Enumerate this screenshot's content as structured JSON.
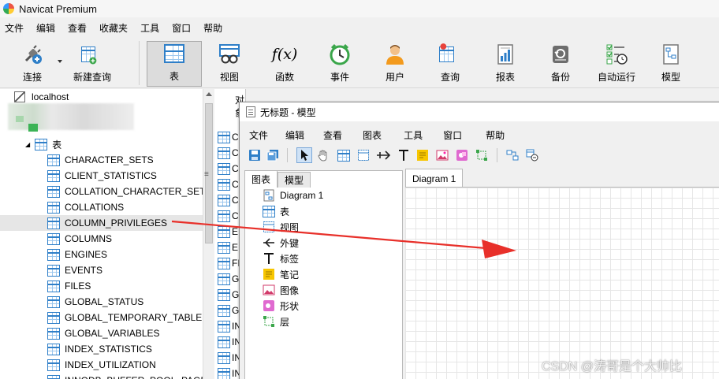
{
  "window": {
    "title": "Navicat Premium"
  },
  "menu": [
    "文件",
    "编辑",
    "查看",
    "收藏夹",
    "工具",
    "窗口",
    "帮助"
  ],
  "toolbar": [
    {
      "label": "连接",
      "icon": "connection-plug-icon"
    },
    {
      "label": "新建查询",
      "icon": "new-query-icon"
    },
    {
      "label": "表",
      "icon": "table-icon",
      "active": true
    },
    {
      "label": "视图",
      "icon": "view-icon"
    },
    {
      "label": "函数",
      "icon": "function-icon",
      "glyph": "f(x)"
    },
    {
      "label": "事件",
      "icon": "event-clock-icon"
    },
    {
      "label": "用户",
      "icon": "user-icon"
    },
    {
      "label": "查询",
      "icon": "query-icon"
    },
    {
      "label": "报表",
      "icon": "report-icon"
    },
    {
      "label": "备份",
      "icon": "backup-icon"
    },
    {
      "label": "自动运行",
      "icon": "auto-run-icon"
    },
    {
      "label": "模型",
      "icon": "model-icon"
    }
  ],
  "tree": {
    "connection": "localhost",
    "tables_node": "表",
    "tables": [
      "CHARACTER_SETS",
      "CLIENT_STATISTICS",
      "COLLATION_CHARACTER_SET_",
      "COLLATIONS",
      "COLUMN_PRIVILEGES",
      "COLUMNS",
      "ENGINES",
      "EVENTS",
      "FILES",
      "GLOBAL_STATUS",
      "GLOBAL_TEMPORARY_TABLES",
      "GLOBAL_VARIABLES",
      "INDEX_STATISTICS",
      "INDEX_UTILIZATION",
      "INNODB_BUFFER_POOL_PAGE"
    ],
    "selected": "COLUMN_PRIVILEGES"
  },
  "objects": {
    "header": "对象",
    "letters": [
      "C",
      "C",
      "C",
      "C",
      "C",
      "C",
      "E",
      "E",
      "FI",
      "G",
      "G",
      "G",
      "IN",
      "IN",
      "IN",
      "IN",
      "IN"
    ]
  },
  "model_window": {
    "title": "无标题 - 模型",
    "menu": [
      "文件",
      "编辑",
      "查看",
      "图表",
      "工具",
      "窗口",
      "帮助"
    ],
    "tabs": [
      "图表",
      "模型"
    ],
    "items": [
      {
        "label": "Diagram 1",
        "icon": "diagram-icon"
      },
      {
        "label": "表",
        "icon": "table-icon"
      },
      {
        "label": "视图",
        "icon": "view-icon"
      },
      {
        "label": "外键",
        "icon": "foreign-key-icon"
      },
      {
        "label": "标签",
        "icon": "label-icon"
      },
      {
        "label": "笔记",
        "icon": "note-icon"
      },
      {
        "label": "图像",
        "icon": "image-icon"
      },
      {
        "label": "形状",
        "icon": "shape-icon"
      },
      {
        "label": "层",
        "icon": "layer-icon"
      }
    ],
    "canvas_tab": "Diagram 1"
  },
  "watermark": "CSDN @涛哥是个大帅比",
  "colors": {
    "accent_blue": "#2f7fc8",
    "arrow_red": "#e8302a",
    "note_yellow": "#f7c600"
  }
}
